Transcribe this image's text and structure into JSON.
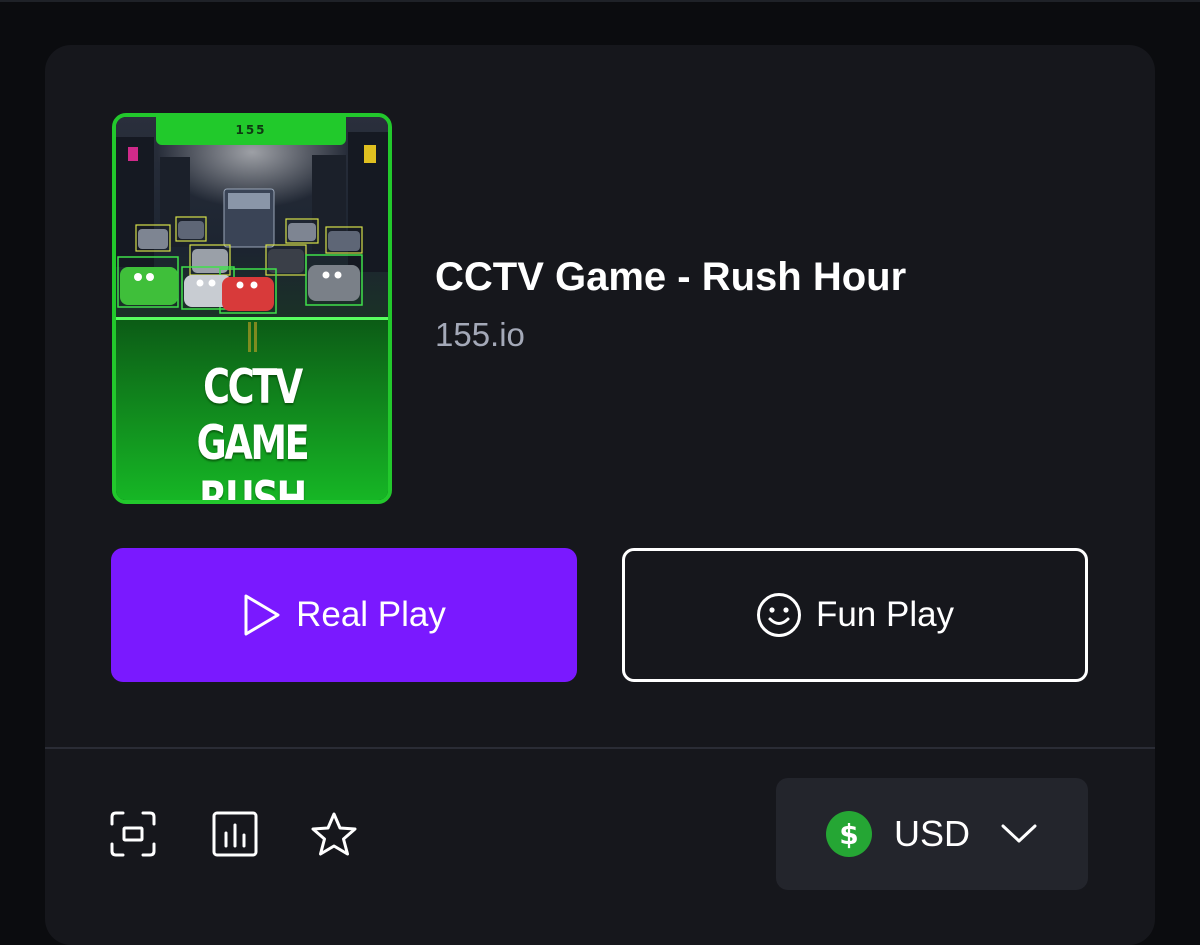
{
  "game": {
    "title": "CCTV Game - Rush Hour",
    "provider": "155.io",
    "thumbnail": {
      "badge": "155",
      "title_line1": "CCTV GAME",
      "title_line2": "RUSH HOUR",
      "accent_color": "#22c82c"
    }
  },
  "actions": {
    "real_play_label": "Real Play",
    "fun_play_label": "Fun Play",
    "real_play_color": "#7a19ff"
  },
  "toolbar": {
    "icons": [
      "fullscreen-icon",
      "stats-icon",
      "star-icon"
    ]
  },
  "currency": {
    "code": "USD",
    "symbol": "$",
    "icon": "dollar-coin-icon",
    "icon_color": "#25a634"
  }
}
